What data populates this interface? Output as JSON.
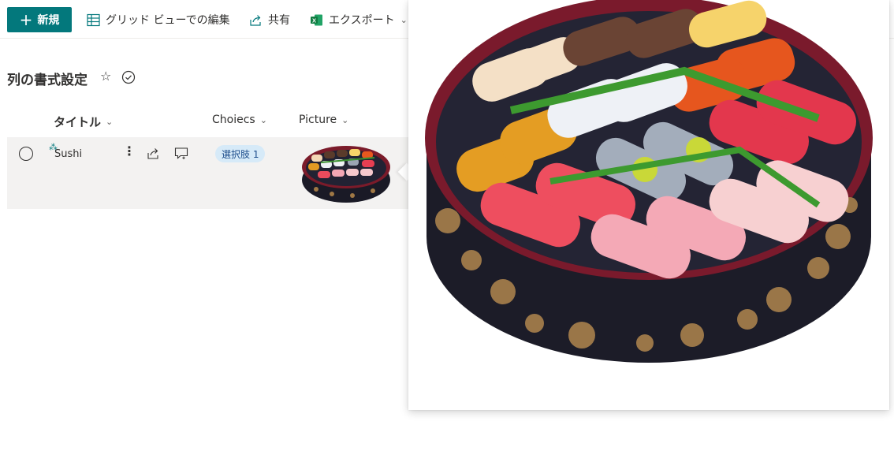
{
  "commandbar": {
    "new_label": "新規",
    "grid_edit_label": "グリッド ビューでの編集",
    "share_label": "共有",
    "export_label": "エクスポート"
  },
  "list": {
    "title": "列の書式設定"
  },
  "columns": {
    "title": "タイトル",
    "choices": "Choiecs",
    "picture": "Picture"
  },
  "rows": [
    {
      "title": "Sushi",
      "choice": "選択肢 1",
      "picture_icon": "sushi-bento-image"
    }
  ],
  "colors": {
    "accent": "#03787c",
    "row_selected_bg": "#f3f2f1",
    "badge_bg": "#d6eaf8",
    "badge_text": "#1e4e8c"
  }
}
